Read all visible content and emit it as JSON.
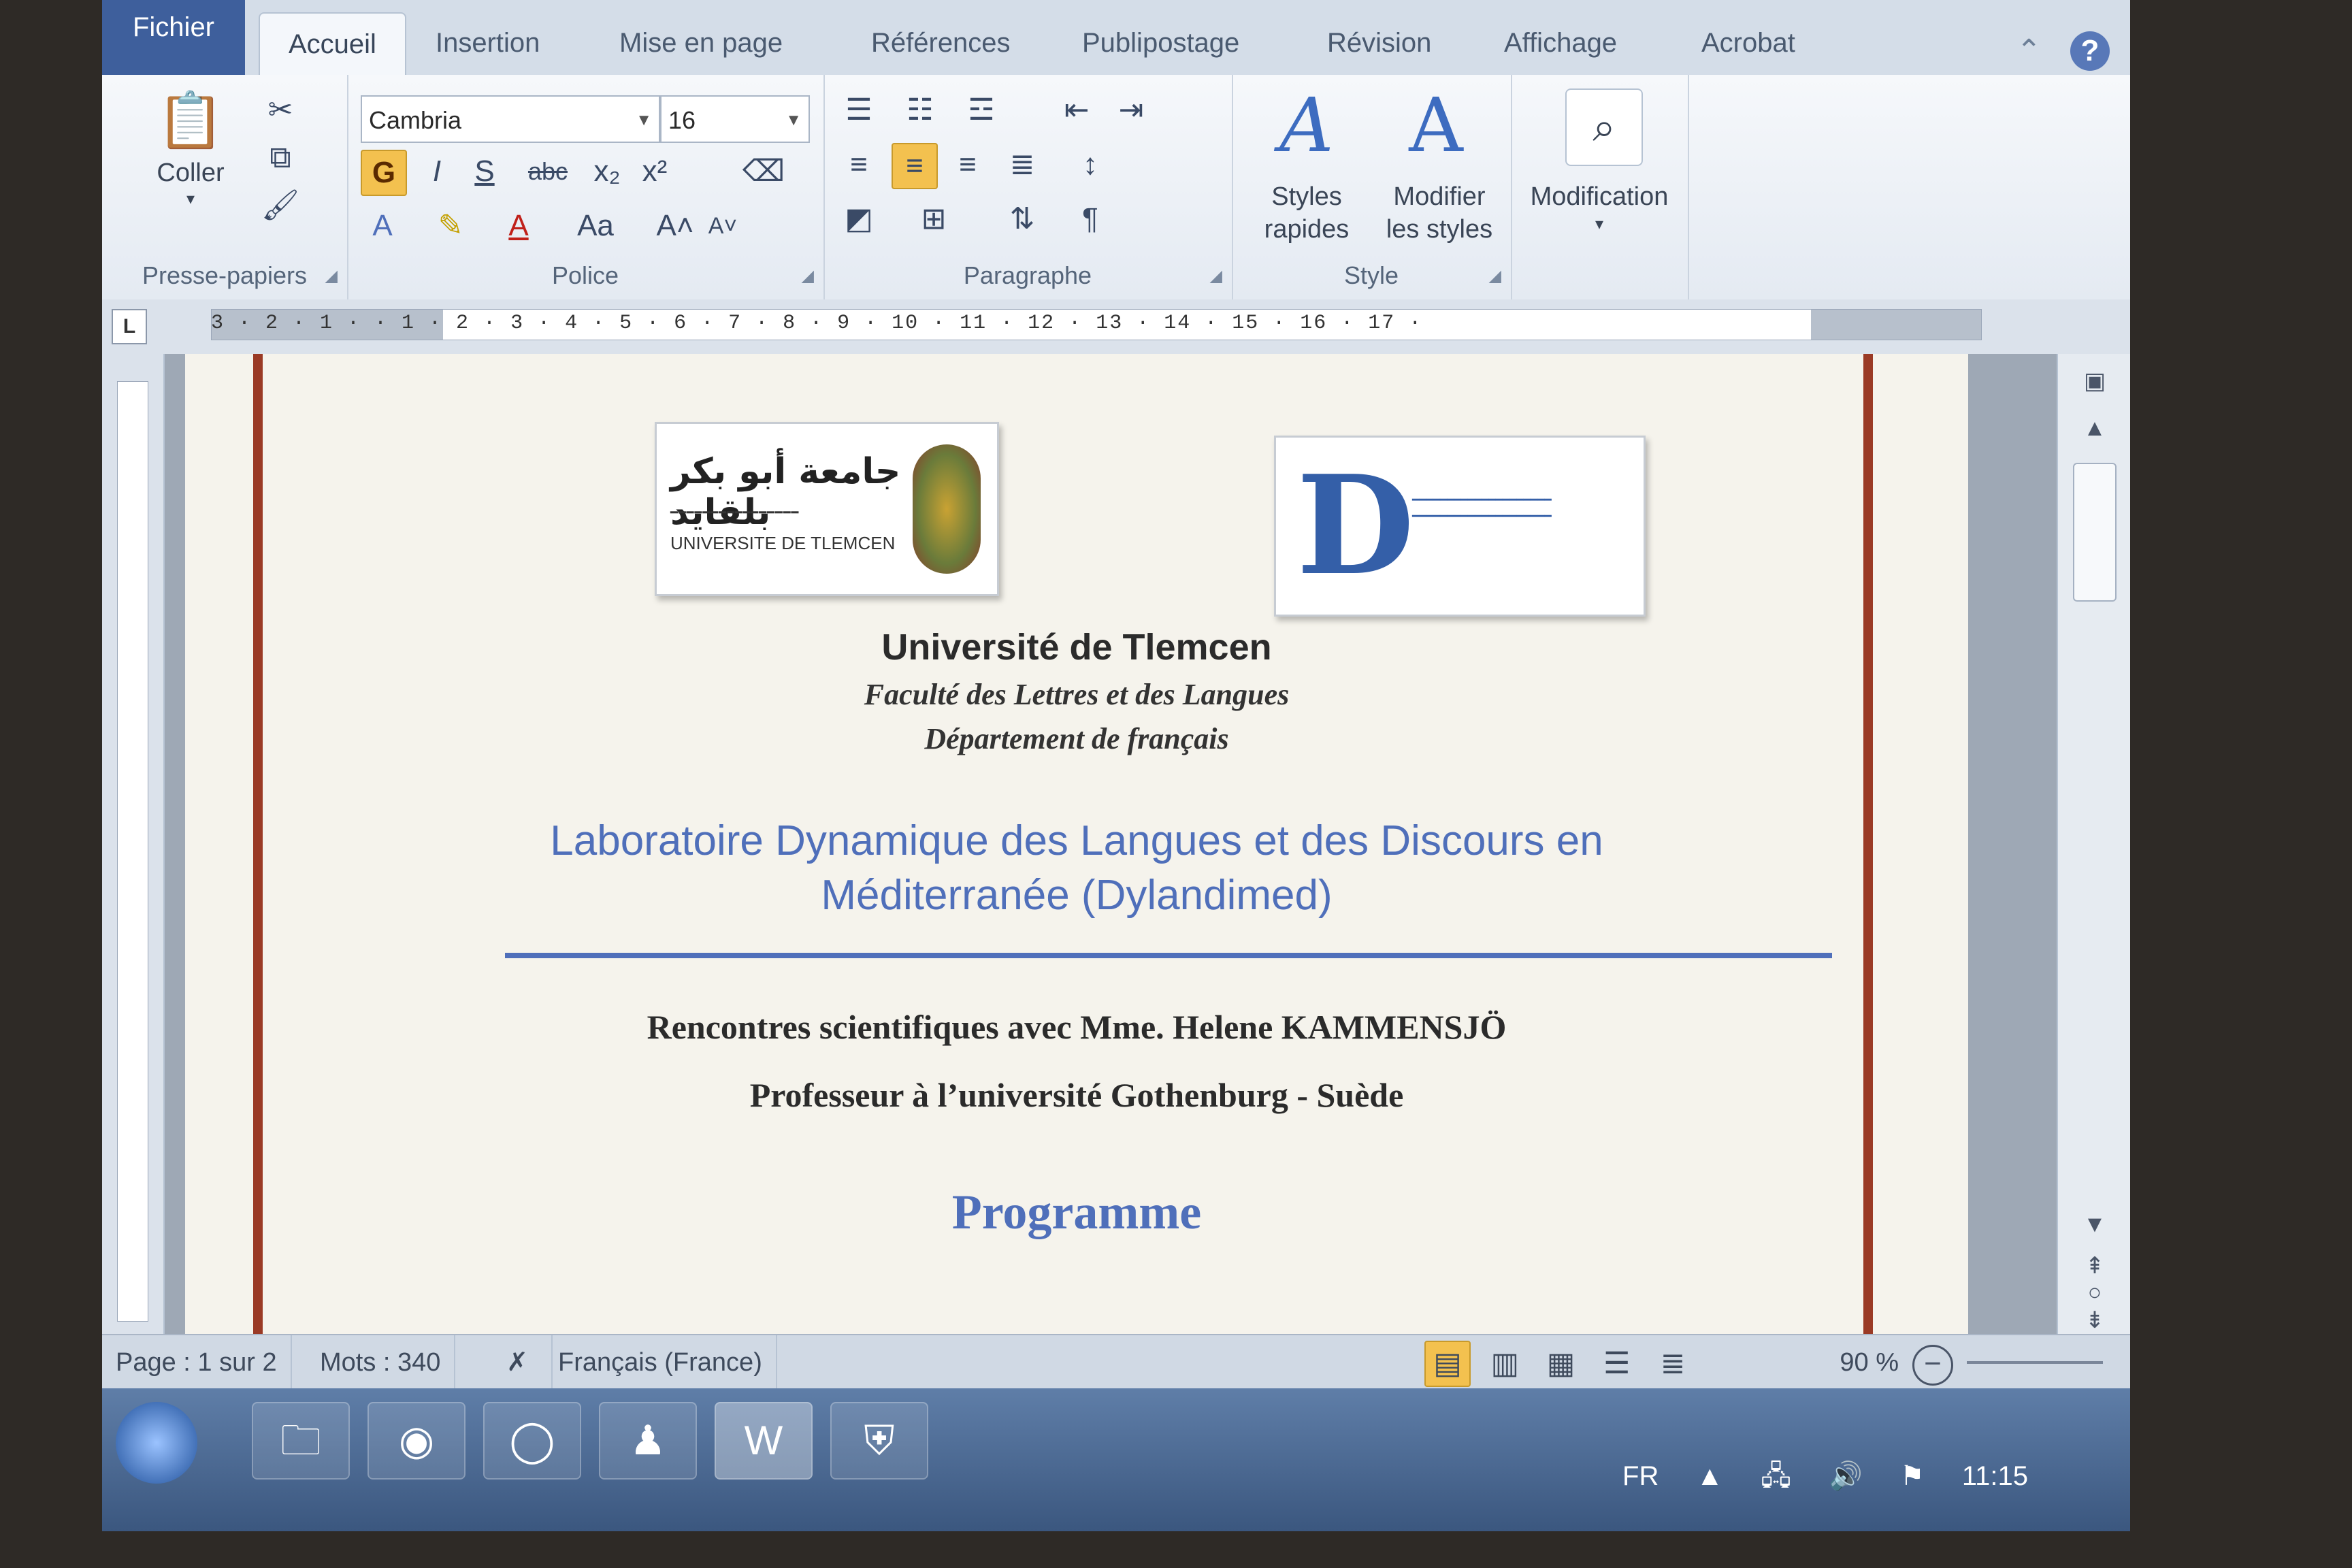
{
  "tabs": [
    {
      "label": "Fichier"
    },
    {
      "label": "Accueil"
    },
    {
      "label": "Insertion"
    },
    {
      "label": "Mise en page"
    },
    {
      "label": "Références"
    },
    {
      "label": "Publipostage"
    },
    {
      "label": "Révision"
    },
    {
      "label": "Affichage"
    },
    {
      "label": "Acrobat"
    }
  ],
  "help_label": "?",
  "ribbon": {
    "clipboard": {
      "paste_label": "Coller",
      "group_label": "Presse-papiers"
    },
    "font": {
      "name": "Cambria",
      "size": "16",
      "group_label": "Police",
      "bold": "G",
      "italic": "I",
      "underline": "S",
      "strike": "abc",
      "subscript": "x₂",
      "superscript": "x²",
      "case": "Aa",
      "grow": "A˄",
      "shrink": "A˅"
    },
    "paragraph": {
      "group_label": "Paragraphe",
      "pilcrow": "¶"
    },
    "style": {
      "quick_styles": "Styles rapides",
      "change_styles": "Modifier les styles",
      "group_label": "Style"
    },
    "editing": {
      "label": "Modification"
    }
  },
  "ruler": {
    "marks": "3 · 2 · 1 ·   · 1 · 2 · 3 · 4 · 5 · 6 · 7 · 8 · 9 · 10 · 11 · 12 · 13 · 14 · 15 · 16 · 17 ·"
  },
  "document": {
    "logo_ut": {
      "arabic": "جامعة أبو بكر بلقايد",
      "univ": "UNIVERSITE DE TLEMCEN"
    },
    "university": "Université de Tlemcen",
    "faculty": "Faculté des Lettres et des Langues",
    "department": "Département de français",
    "lab_line1": "Laboratoire Dynamique des Langues et des Discours en",
    "lab_line2": "Méditerranée (Dylandimed)",
    "meeting": "Rencontres scientifiques avec Mme. Helene KAMMENSJÖ",
    "professor": "Professeur à l’université Gothenburg - Suède",
    "programme": "Programme"
  },
  "status": {
    "page": "Page : 1 sur 2",
    "words": "Mots : 340",
    "language": "Français (France)",
    "zoom": "90 %"
  },
  "tray": {
    "lang": "FR",
    "time": "11:15"
  }
}
